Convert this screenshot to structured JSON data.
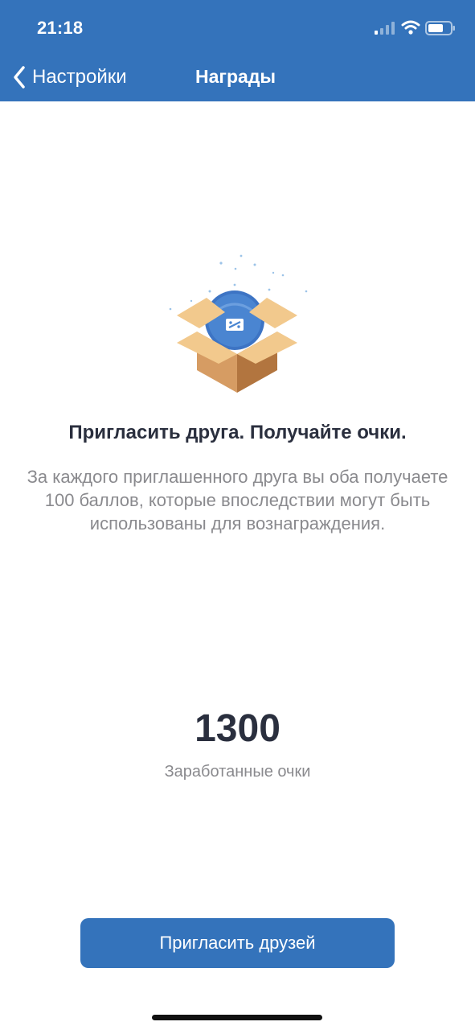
{
  "status_bar": {
    "time": "21:18"
  },
  "nav": {
    "back_label": "Настройки",
    "title": "Награды"
  },
  "promo": {
    "headline": "Пригласить друга. Получайте очки.",
    "description": "За каждого приглашенного друга вы оба получаете 100 баллов, которые впоследствии могут быть использованы для вознаграждения."
  },
  "points": {
    "value": "1300",
    "caption": "Заработанные очки"
  },
  "actions": {
    "invite_label": "Пригласить друзей"
  },
  "colors": {
    "brand": "#3473bb",
    "heading": "#2a2f3e",
    "muted": "#8a8a8e"
  },
  "icons": [
    "signal-icon",
    "wifi-icon",
    "battery-icon",
    "chevron-left-icon",
    "gift-box-icon"
  ]
}
